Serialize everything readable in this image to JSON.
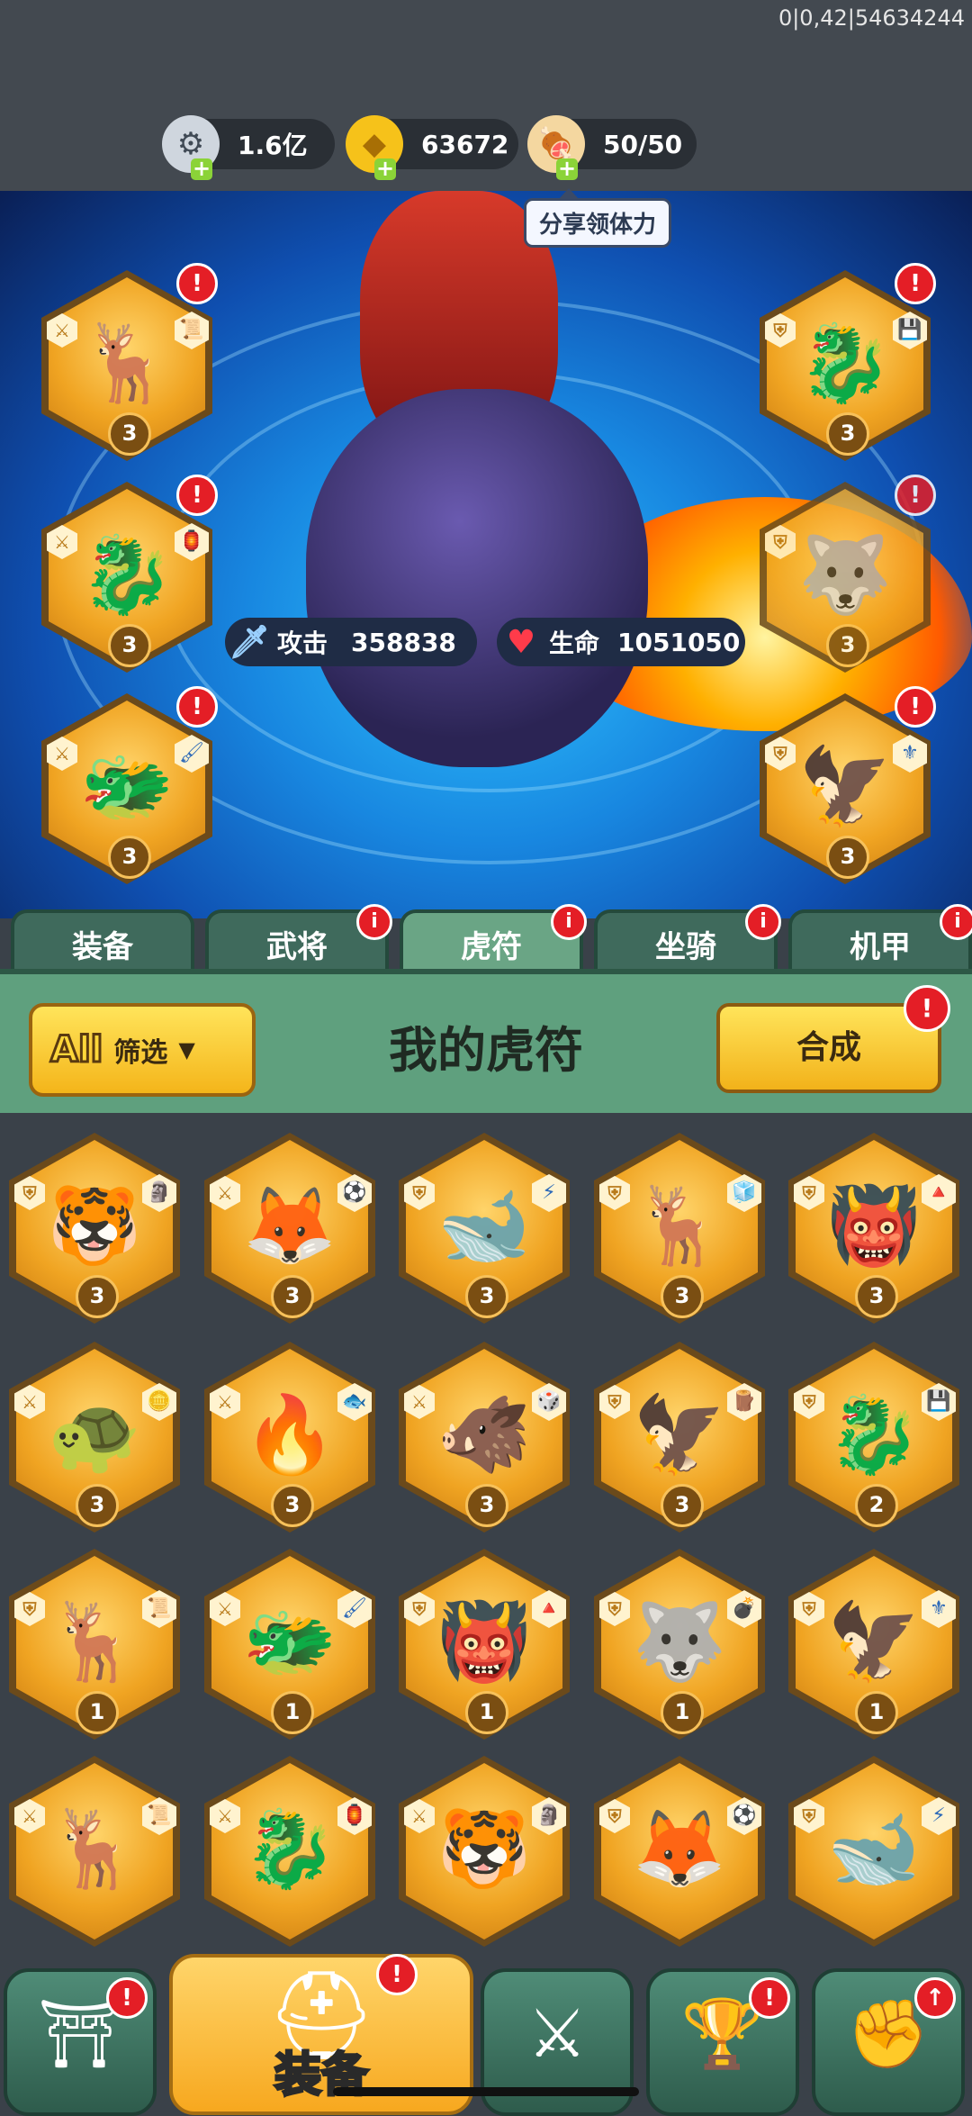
{
  "debug_text": "0|0,42|54634244",
  "resources": [
    {
      "name": "silver",
      "icon": "⚙",
      "value": "1.6亿"
    },
    {
      "name": "gold",
      "icon": "◆",
      "value": "63672"
    },
    {
      "name": "stamina",
      "icon": "🍖",
      "value": "50/50"
    }
  ],
  "share_tip": "分享领体力",
  "stats": {
    "attack_label": "攻击",
    "attack_value": "358838",
    "hp_label": "生命",
    "hp_value": "1051050"
  },
  "equipped_left": [
    {
      "glyph": "🦌",
      "level": "3",
      "tag": "📜"
    },
    {
      "glyph": "🐉",
      "level": "3",
      "tag": "🏮"
    },
    {
      "glyph": "🐲",
      "level": "3",
      "tag": "🖌"
    }
  ],
  "equipped_right": [
    {
      "glyph": "🐉",
      "level": "3",
      "tag": "💾"
    },
    {
      "glyph": "🐺",
      "level": "3",
      "tag": ""
    },
    {
      "glyph": "🦅",
      "level": "3",
      "tag": "⚜"
    }
  ],
  "tabs": [
    {
      "label": "装备",
      "active": false,
      "alert": false
    },
    {
      "label": "武将",
      "active": false,
      "alert": true
    },
    {
      "label": "虎符",
      "active": true,
      "alert": true
    },
    {
      "label": "坐骑",
      "active": false,
      "alert": true
    },
    {
      "label": "机甲",
      "active": false,
      "alert": true
    }
  ],
  "panel": {
    "filter_all": "All",
    "filter_label": "筛选",
    "title": "我的虎符",
    "merge_label": "合成"
  },
  "items": [
    {
      "glyph": "🐯",
      "level": "3",
      "tag": "🗿"
    },
    {
      "glyph": "🦊",
      "level": "3",
      "tag": "⚽"
    },
    {
      "glyph": "🐋",
      "level": "3",
      "tag": "⚡"
    },
    {
      "glyph": "🦌",
      "level": "3",
      "tag": "🧊"
    },
    {
      "glyph": "👹",
      "level": "3",
      "tag": "🔺"
    },
    {
      "glyph": "🐢",
      "level": "3",
      "tag": "🪙"
    },
    {
      "glyph": "🔥",
      "level": "3",
      "tag": "🐟"
    },
    {
      "glyph": "🐗",
      "level": "3",
      "tag": "🎲"
    },
    {
      "glyph": "🦅",
      "level": "3",
      "tag": "🪵"
    },
    {
      "glyph": "🐉",
      "level": "2",
      "tag": "💾"
    },
    {
      "glyph": "🦌",
      "level": "1",
      "tag": "📜"
    },
    {
      "glyph": "🐲",
      "level": "1",
      "tag": "🖌"
    },
    {
      "glyph": "👹",
      "level": "1",
      "tag": "🔺"
    },
    {
      "glyph": "🐺",
      "level": "1",
      "tag": "💣"
    },
    {
      "glyph": "🦅",
      "level": "1",
      "tag": "⚜"
    },
    {
      "glyph": "🦌",
      "level": "",
      "tag": "📜"
    },
    {
      "glyph": "🐉",
      "level": "",
      "tag": "🏮"
    },
    {
      "glyph": "🐯",
      "level": "",
      "tag": "🗿"
    },
    {
      "glyph": "🦊",
      "level": "",
      "tag": "⚽"
    },
    {
      "glyph": "🐋",
      "level": "",
      "tag": "⚡"
    }
  ],
  "bottom_nav": [
    {
      "icon": "⛩",
      "label": "",
      "alert": "!"
    },
    {
      "icon": "⛑",
      "label": "装备",
      "alert": "!"
    },
    {
      "icon": "⚔",
      "label": "",
      "alert": ""
    },
    {
      "icon": "🏆",
      "label": "",
      "alert": "!"
    },
    {
      "icon": "✊",
      "label": "",
      "alert": "↑"
    }
  ]
}
